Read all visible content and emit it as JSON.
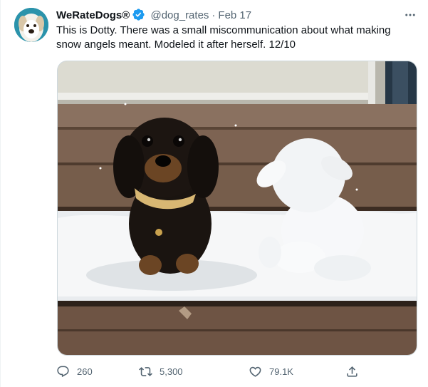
{
  "tweet": {
    "display_name": "WeRateDogs®",
    "handle": "@dog_rates",
    "separator": "·",
    "date": "Feb 17",
    "text": "This is Dotty. There was a small miscommunication about what making snow angels meant. Modeled it after herself. 12/10"
  },
  "actions": {
    "replies": "260",
    "retweets": "5,300",
    "likes": "79.1K"
  },
  "icons": {
    "verified": "verified-badge-icon",
    "more": "more-dots-icon",
    "reply": "reply-icon",
    "retweet": "retweet-icon",
    "like": "heart-icon",
    "share": "share-icon"
  },
  "colors": {
    "verified": "#1d9bf0",
    "secondary_text": "#536471",
    "primary_text": "#0f1419"
  }
}
